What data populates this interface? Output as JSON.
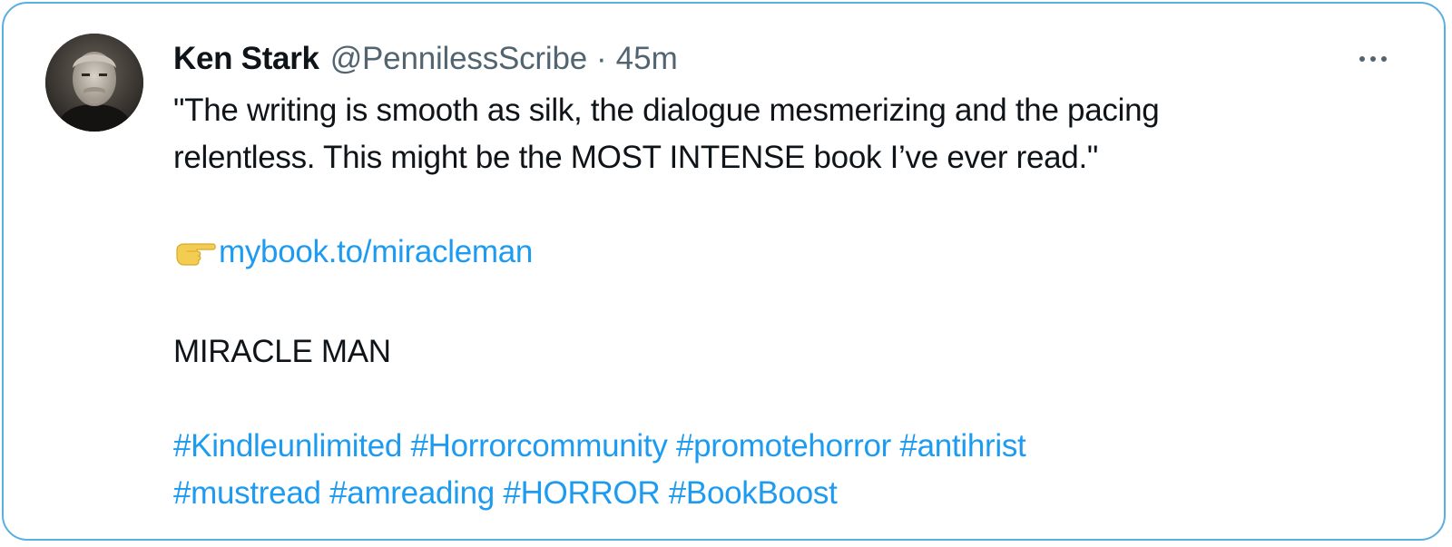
{
  "tweet": {
    "author": {
      "name": "Ken Stark",
      "handle": "@PennilessScribe",
      "separator": "·",
      "timestamp": "45m"
    },
    "text": {
      "line1": "\"The writing is smooth as silk, the dialogue mesmerizing and the pacing",
      "line2": "relentless. This might be the MOST INTENSE book I’ve ever read.\"",
      "link_icon": "backhand-index-pointing-right-icon",
      "link": "mybook.to/miraclema n",
      "title": "MIRACLE MAN"
    },
    "hashtags_line1": [
      "#Kindleunlimited",
      "#Horrorcommunity",
      "#promotehorror",
      "#antihrist"
    ],
    "hashtags_line2": [
      "#mustread",
      "#amreading",
      "#HORROR",
      "#BookBoost"
    ]
  },
  "colors": {
    "card_border": "#5aaee0",
    "link": "#1d9bf0",
    "secondary_text": "#536471",
    "primary_text": "#0f1419"
  }
}
